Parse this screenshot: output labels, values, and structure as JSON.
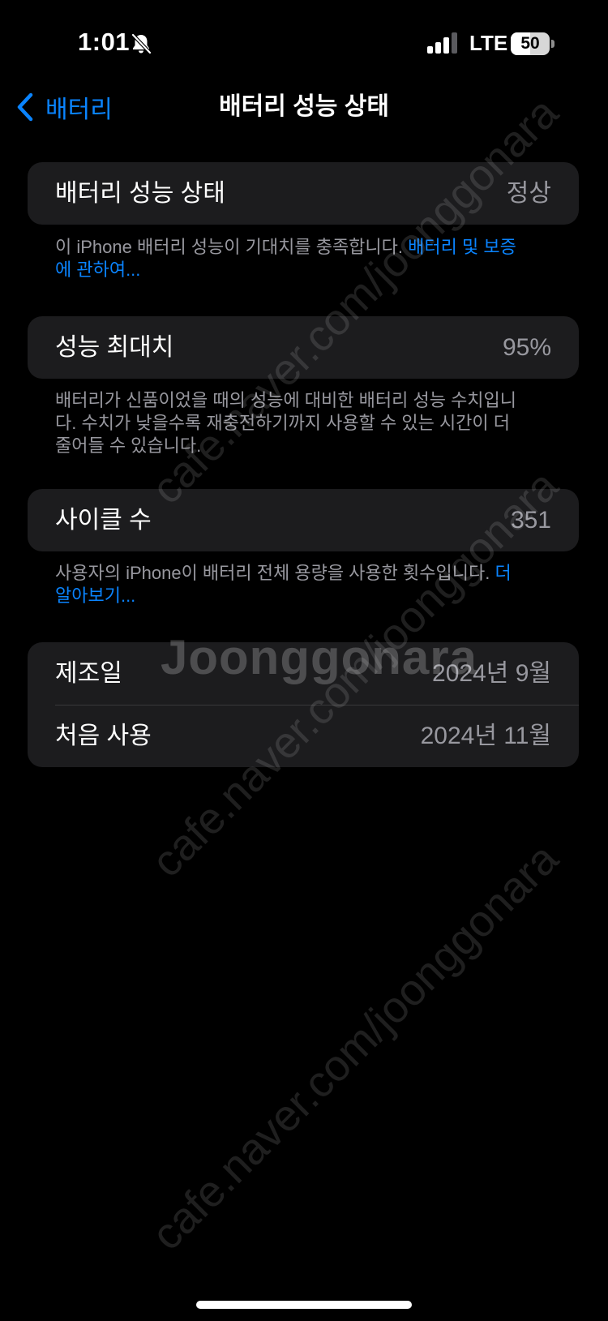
{
  "status_bar": {
    "time": "1:01",
    "network": "LTE",
    "battery_level": "50",
    "battery_fraction": 0.5
  },
  "nav": {
    "back_label": "배터리",
    "title": "배터리 성능 상태"
  },
  "health": {
    "label": "배터리 성능 상태",
    "value": "정상",
    "footnote_text": "이 iPhone 배터리 성능이 기대치를 충족합니다. ",
    "footnote_link": "배터리 및 보증에 관하여..."
  },
  "max_capacity": {
    "label": "성능 최대치",
    "value": "95%",
    "footnote_text": "배터리가 신품이었을 때의 성능에 대비한 배터리 성능 수치입니다. 수치가 낮을수록 재충전하기까지 사용할 수 있는 시간이 더 줄어들 수 있습니다."
  },
  "cycle_count": {
    "label": "사이클 수",
    "value": "351",
    "footnote_text": "사용자의 iPhone이 배터리 전체 용량을 사용한 횟수입니다. ",
    "footnote_link": "더 알아보기..."
  },
  "dates": {
    "manufacture_label": "제조일",
    "manufacture_value": "2024년 9월",
    "first_use_label": "처음 사용",
    "first_use_value": "2024년 11월"
  },
  "watermark": {
    "brand": "Joonggonara",
    "url": "cafe.naver.com/joonggonara"
  },
  "icons": {
    "bell": "bell-slash-icon",
    "signal": "cellular-signal-icon",
    "battery": "battery-icon",
    "back": "chevron-left-icon"
  },
  "colors": {
    "background": "#000000",
    "card": "#1c1c1e",
    "accent": "#0a84ff",
    "secondary_text": "#98989f"
  }
}
